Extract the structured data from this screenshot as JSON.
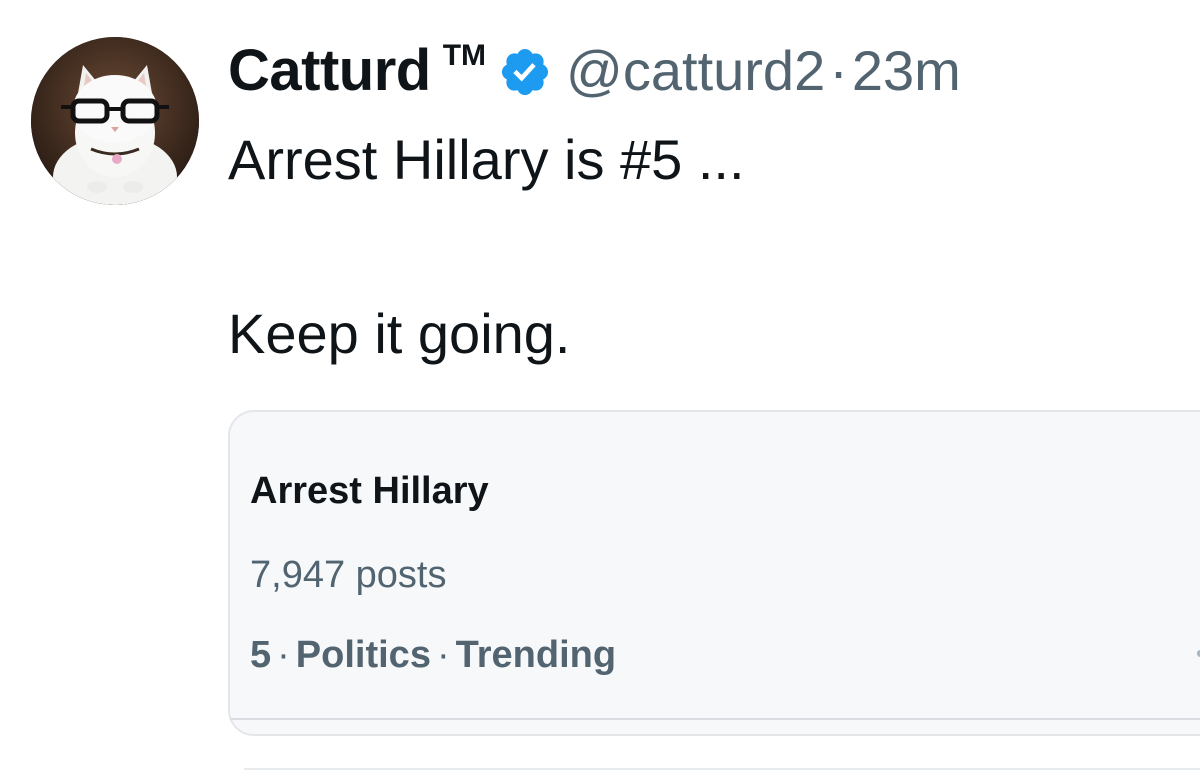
{
  "tweet": {
    "author": {
      "display_name": "Catturd",
      "badge_text": "TM",
      "verified_icon": "verified-badge-icon",
      "handle": "@catturd2",
      "separator": "·",
      "time": "23m"
    },
    "text_lines": [
      "Arrest Hillary is #5 ...",
      "Keep it going."
    ]
  },
  "trend_card": {
    "name": "Arrest Hillary",
    "posts": "7,947 posts",
    "rank": "5",
    "category": "Politics",
    "status": "Trending",
    "separator": "·",
    "more_icon": "more-dots-icon"
  },
  "colors": {
    "text_primary": "#0f1419",
    "text_secondary": "#536471",
    "verified_blue": "#1d9bf0",
    "card_bg": "#f7f8fa",
    "card_border": "#e4e6ea"
  }
}
